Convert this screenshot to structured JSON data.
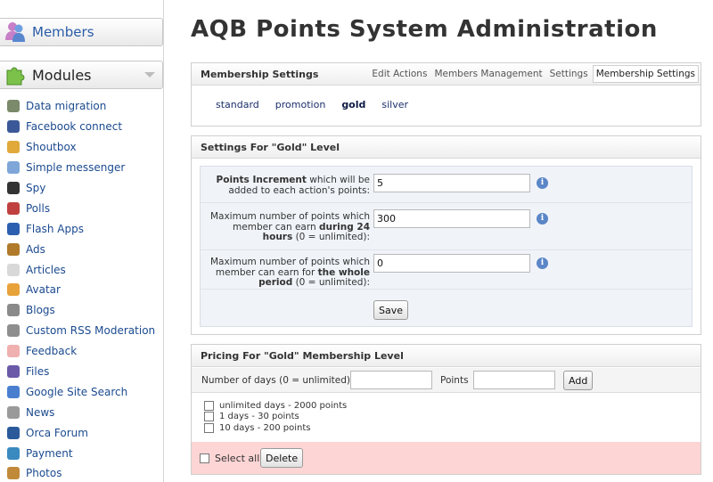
{
  "sidebar": {
    "members_label": "Members",
    "modules_label": "Modules",
    "items": [
      {
        "label": "Data migration",
        "icon": "gear-icon",
        "color": "#7a8a6a"
      },
      {
        "label": "Facebook connect",
        "icon": "facebook-icon",
        "color": "#3b5998"
      },
      {
        "label": "Shoutbox",
        "icon": "megaphone-icon",
        "color": "#e0a93a"
      },
      {
        "label": "Simple messenger",
        "icon": "chat-bubble-icon",
        "color": "#7fa6d8"
      },
      {
        "label": "Spy",
        "icon": "spy-icon",
        "color": "#333333"
      },
      {
        "label": "Polls",
        "icon": "bar-chart-icon",
        "color": "#c04040"
      },
      {
        "label": "Flash Apps",
        "icon": "flash-apps-icon",
        "color": "#2d5fb0"
      },
      {
        "label": "Ads",
        "icon": "briefcase-icon",
        "color": "#b07a2a"
      },
      {
        "label": "Articles",
        "icon": "document-icon",
        "color": "#d8d8d8"
      },
      {
        "label": "Avatar",
        "icon": "avatar-face-icon",
        "color": "#e8a23a"
      },
      {
        "label": "Blogs",
        "icon": "notepad-icon",
        "color": "#8a8a8a"
      },
      {
        "label": "Custom RSS Moderation",
        "icon": "gear-rss-icon",
        "color": "#8e8e8e"
      },
      {
        "label": "Feedback",
        "icon": "feedback-icon",
        "color": "#f0b0b0"
      },
      {
        "label": "Files",
        "icon": "floppy-disk-icon",
        "color": "#6a5aa8"
      },
      {
        "label": "Google Site Search",
        "icon": "google-icon",
        "color": "#4a7fd0"
      },
      {
        "label": "News",
        "icon": "news-tag-icon",
        "color": "#9a9a9a"
      },
      {
        "label": "Orca Forum",
        "icon": "orca-icon",
        "color": "#2a5a9a"
      },
      {
        "label": "Payment",
        "icon": "payment-icon",
        "color": "#3a8ac0"
      },
      {
        "label": "Photos",
        "icon": "photos-icon",
        "color": "#c08a3a"
      }
    ]
  },
  "header": {
    "title": "AQB Points System Administration"
  },
  "membership_settings": {
    "title": "Membership Settings",
    "nav": [
      "Edit Actions",
      "Members Management",
      "Settings",
      "Membership Settings"
    ],
    "active_nav": "Membership Settings",
    "levels": [
      "standard",
      "promotion",
      "gold",
      "silver"
    ],
    "selected_level": "gold"
  },
  "level_settings": {
    "title": "Settings For \"Gold\" Level",
    "increment_label_bold": "Points Increment",
    "increment_label_rest": " which will be added to each action's points:",
    "increment_value": "5",
    "daily_label_pre": "Maximum number of points which member can earn ",
    "daily_label_bold": "during 24 hours",
    "daily_label_post": " (0 = unlimited):",
    "daily_value": "300",
    "period_label_pre": "Maximum number of points which member can earn for ",
    "period_label_bold": "the whole period",
    "period_label_post": " (0 = unlimited):",
    "period_value": "0",
    "info_glyph": "i",
    "save_label": "Save"
  },
  "pricing": {
    "title": "Pricing For \"Gold\" Membership Level",
    "days_label": "Number of days (0 = unlimited)",
    "days_value": "",
    "points_label": "Points",
    "points_value": "",
    "add_label": "Add",
    "options": [
      "unlimited days - 2000 points",
      "1 days - 30 points",
      "10 days - 200 points"
    ],
    "select_all_label": "Select all",
    "delete_label": "Delete"
  }
}
